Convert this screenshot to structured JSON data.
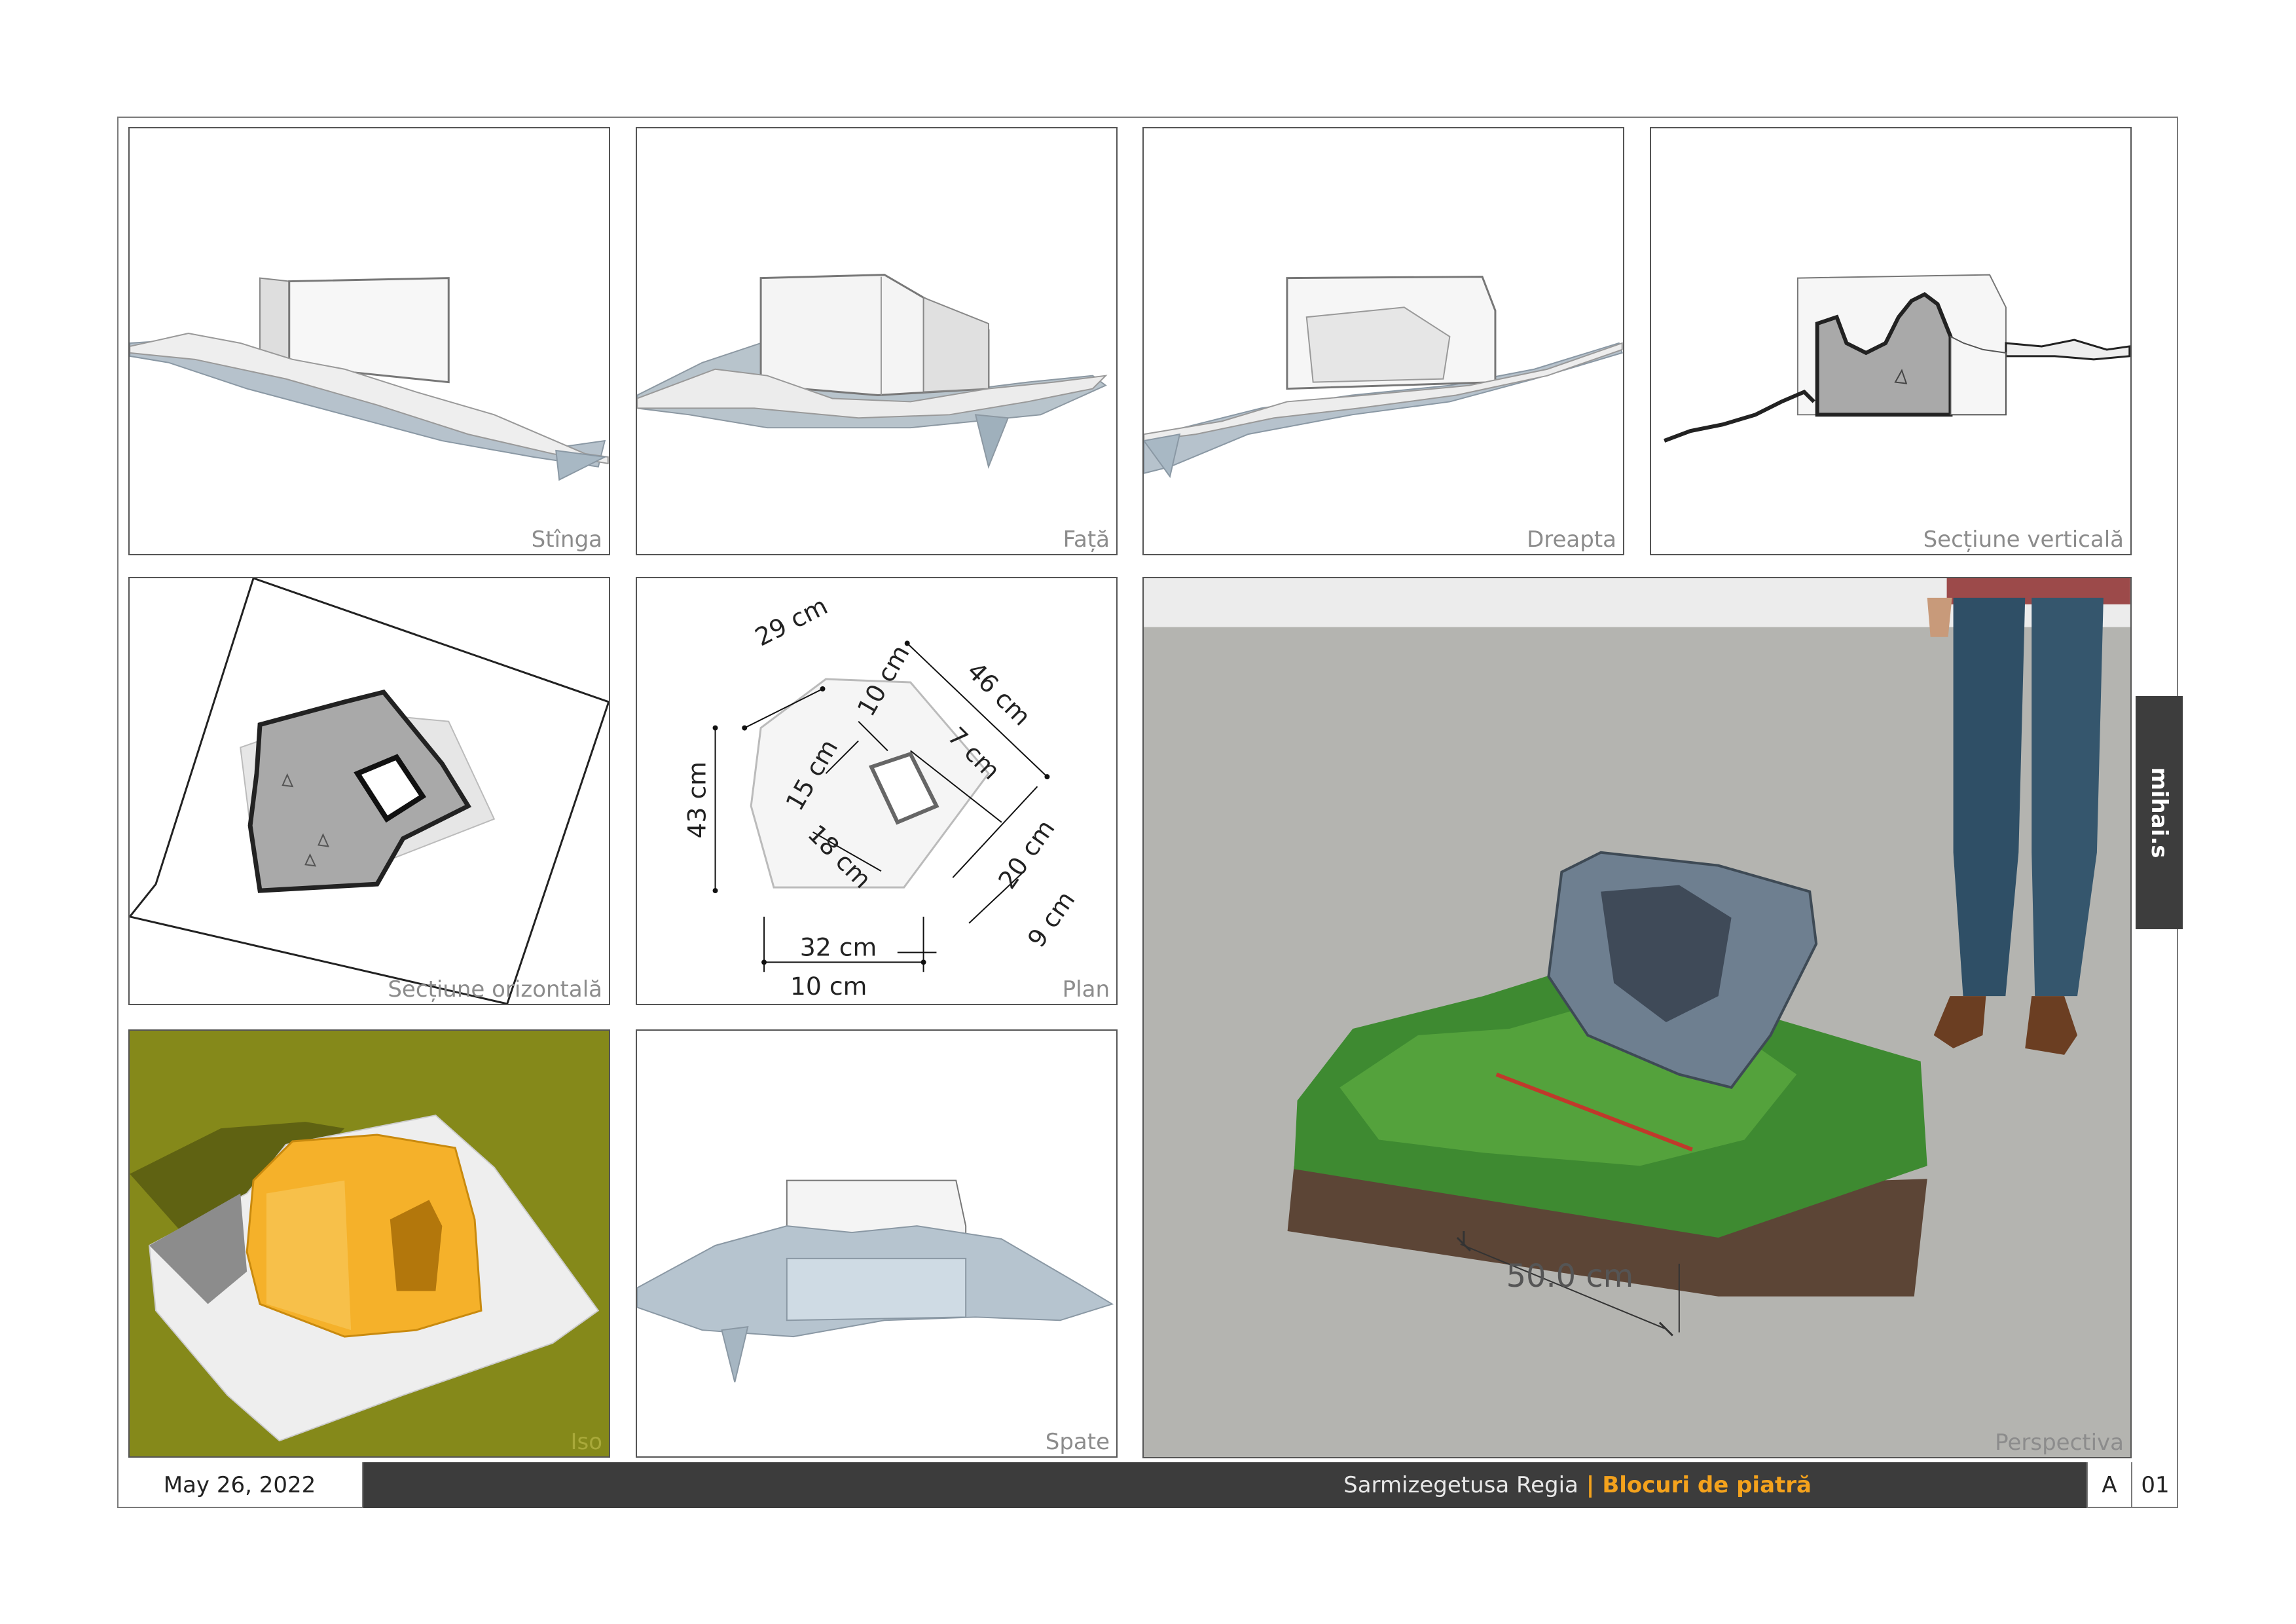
{
  "panels": {
    "left": "Stînga",
    "front": "Față",
    "right": "Dreapta",
    "vertical_section": "Secțiune verticală",
    "horizontal_section": "Secțiune orizontală",
    "plan": "Plan",
    "iso": "Iso",
    "back": "Spate",
    "perspective": "Perspectiva"
  },
  "plan_dimensions": {
    "d29": "29 cm",
    "d46": "46 cm",
    "d10a": "10 cm",
    "d7": "7 cm",
    "d15": "15 cm",
    "d43": "43 cm",
    "d18": "18 cm",
    "d20": "20 cm",
    "d9": "9 cm",
    "d32": "32 cm",
    "d10b": "10 cm"
  },
  "perspective_dimension": "50.0 cm",
  "author": "mihai.s",
  "footer": {
    "date": "May 26, 2022",
    "project": "Sarmizegetusa Regia",
    "separator": "|",
    "title": "Blocuri de piatră",
    "sheet_series": "A",
    "sheet_number": "01"
  },
  "colors": {
    "accent": "#f4a21c",
    "footer_bar": "#3c3c3c",
    "iso_background": "#85891a",
    "iso_block": "#f5b12a",
    "section_fill": "#a9a9a9"
  }
}
